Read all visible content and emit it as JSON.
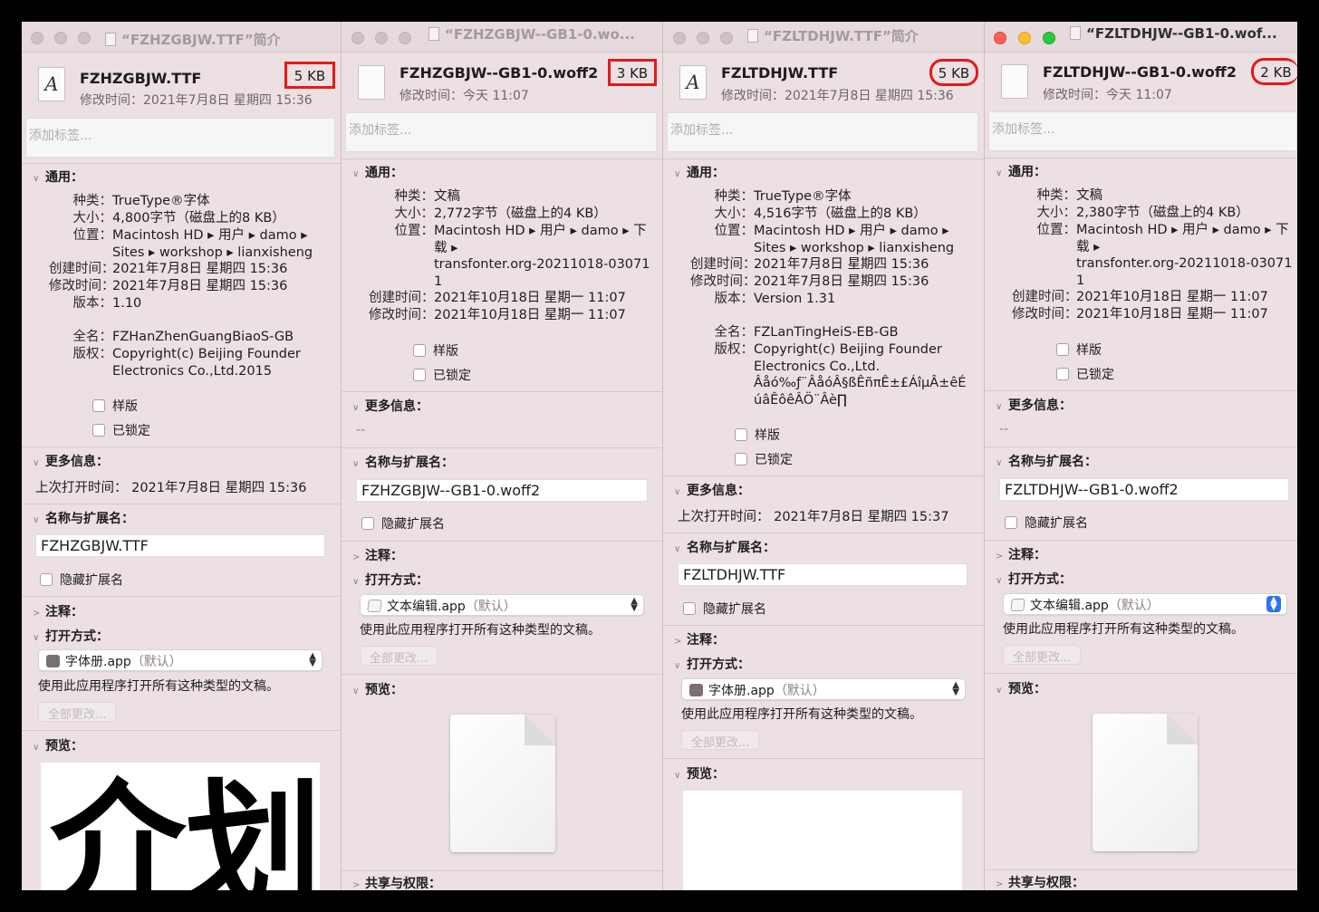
{
  "panels": [
    {
      "id": "p1",
      "title": "“FZHZGBJW.TTF”简介",
      "file_name": "FZHZGBJW.TTF",
      "modified_label": "修改时间：",
      "modified": "2021年7月8日 星期四 15:36",
      "size_badge": "5 KB",
      "tags_placeholder": "添加标签...",
      "general_label": "通用：",
      "kind_l": "种类：",
      "kind": "TrueType®字体",
      "size_l": "大小：",
      "size": "4,800字节（磁盘上的8 KB）",
      "where_l": "位置：",
      "where1": "Macintosh HD ▸ 用户 ▸ damo ▸",
      "where2": "Sites ▸ workshop ▸ lianxisheng",
      "created_l": "创建时间：",
      "created": "2021年7月8日 星期四 15:36",
      "mod_l": "修改时间：",
      "mod": "2021年7月8日 星期四 15:36",
      "version_l": "版本：",
      "version": "1.10",
      "fullname_l": "全名：",
      "fullname": "FZHanZhenGuangBiaoS-GB",
      "copyright_l": "版权：",
      "copyright1": "Copyright(c) Beijing Founder",
      "copyright2": "Electronics Co.,Ltd.2015",
      "stationery": "样版",
      "locked": "已锁定",
      "more_label": "更多信息：",
      "last_opened": "上次打开时间：  2021年7月8日 星期四 15:36",
      "name_ext_label": "名称与扩展名：",
      "name_value": "FZHZGBJW.TTF",
      "hide_ext": "隐藏扩展名",
      "comments_label": "注释：",
      "open_with_label": "打开方式：",
      "app": "字体册.app",
      "app_default": "（默认）",
      "use_app_note": "使用此应用程序打开所有这种类型的文稿。",
      "change_all": "全部更改...",
      "preview_label": "预览：",
      "preview_glyphs": "介划"
    },
    {
      "id": "p2",
      "title": "“FZHZGBJW--GB1-0.wo...",
      "file_name": "FZHZGBJW--GB1-0.woff2",
      "modified_label": "修改时间：",
      "modified": "今天 11:07",
      "size_badge": "3 KB",
      "tags_placeholder": "添加标签...",
      "general_label": "通用：",
      "kind_l": "种类：",
      "kind": "文稿",
      "size_l": "大小：",
      "size": "2,772字节（磁盘上的4 KB）",
      "where_l": "位置：",
      "where1": "Macintosh HD ▸ 用户 ▸ damo ▸ 下",
      "where2": "载 ▸",
      "where3": "transfonter.org-20211018-03071",
      "where4": "1",
      "created_l": "创建时间：",
      "created": "2021年10月18日 星期一 11:07",
      "mod_l": "修改时间：",
      "mod": "2021年10月18日 星期一 11:07",
      "stationery": "样版",
      "locked": "已锁定",
      "more_label": "更多信息：",
      "more_value": "--",
      "name_ext_label": "名称与扩展名：",
      "name_value": "FZHZGBJW--GB1-0.woff2",
      "hide_ext": "隐藏扩展名",
      "comments_label": "注释：",
      "open_with_label": "打开方式：",
      "app": "文本编辑.app",
      "app_default": "（默认）",
      "use_app_note": "使用此应用程序打开所有这种类型的文稿。",
      "change_all": "全部更改...",
      "preview_label": "预览：",
      "sharing_label": "共享与权限："
    },
    {
      "id": "p3",
      "title": "“FZLTDHJW.TTF”简介",
      "file_name": "FZLTDHJW.TTF",
      "modified_label": "修改时间：",
      "modified": "2021年7月8日 星期四 15:36",
      "size_badge": "5 KB",
      "tags_placeholder": "添加标签...",
      "general_label": "通用：",
      "kind_l": "种类：",
      "kind": "TrueType®字体",
      "size_l": "大小：",
      "size": "4,516字节（磁盘上的8 KB）",
      "where_l": "位置：",
      "where1": "Macintosh HD ▸ 用户 ▸ damo ▸",
      "where2": "Sites ▸ workshop ▸ lianxisheng",
      "created_l": "创建时间：",
      "created": "2021年7月8日 星期四 15:36",
      "mod_l": "修改时间：",
      "mod": "2021年7月8日 星期四 15:36",
      "version_l": "版本：",
      "version": "Version 1.31",
      "fullname_l": "全名：",
      "fullname": "FZLanTingHeiS-EB-GB",
      "copyright_l": "版权：",
      "copyright1": "Copyright(c) Beijing Founder",
      "copyright2": "Electronics Co.,Ltd.",
      "copyright3": "Âåó‰ƒ¨ÂåóÂ§ßÊñπÊ±£ÁîµÂ±êÉ",
      "copyright4": "úâÊôêÂÖ¨Âè∏",
      "stationery": "样版",
      "locked": "已锁定",
      "more_label": "更多信息：",
      "last_opened": "上次打开时间：  2021年7月8日 星期四 15:37",
      "name_ext_label": "名称与扩展名：",
      "name_value": "FZLTDHJW.TTF",
      "hide_ext": "隐藏扩展名",
      "comments_label": "注释：",
      "open_with_label": "打开方式：",
      "app": "字体册.app",
      "app_default": "（默认）",
      "use_app_note": "使用此应用程序打开所有这种类型的文稿。",
      "change_all": "全部更改...",
      "preview_label": "预览："
    },
    {
      "id": "p4",
      "title": "“FZLTDHJW--GB1-0.wof...",
      "file_name": "FZLTDHJW--GB1-0.woff2",
      "modified_label": "修改时间：",
      "modified": "今天 11:07",
      "size_badge": "2 KB",
      "tags_placeholder": "添加标签...",
      "general_label": "通用：",
      "kind_l": "种类：",
      "kind": "文稿",
      "size_l": "大小：",
      "size": "2,380字节（磁盘上的4 KB）",
      "where_l": "位置：",
      "where1": "Macintosh HD ▸ 用户 ▸ damo ▸ 下",
      "where2": "载 ▸",
      "where3": "transfonter.org-20211018-03071",
      "where4": "1",
      "created_l": "创建时间：",
      "created": "2021年10月18日 星期一 11:07",
      "mod_l": "修改时间：",
      "mod": "2021年10月18日 星期一 11:07",
      "stationery": "样版",
      "locked": "已锁定",
      "more_label": "更多信息：",
      "more_value": "--",
      "name_ext_label": "名称与扩展名：",
      "name_value": "FZLTDHJW--GB1-0.woff2",
      "hide_ext": "隐藏扩展名",
      "comments_label": "注释：",
      "open_with_label": "打开方式：",
      "app": "文本编辑.app",
      "app_default": "（默认）",
      "use_app_note": "使用此应用程序打开所有这种类型的文稿。",
      "change_all": "全部更改...",
      "preview_label": "预览：",
      "sharing_label": "共享与权限："
    }
  ],
  "colors": {
    "annotation": "#e21a1a",
    "window_bg": "#ece0e2",
    "close": "#ff5f57",
    "minimize": "#febc2e",
    "zoom": "#28c840"
  }
}
